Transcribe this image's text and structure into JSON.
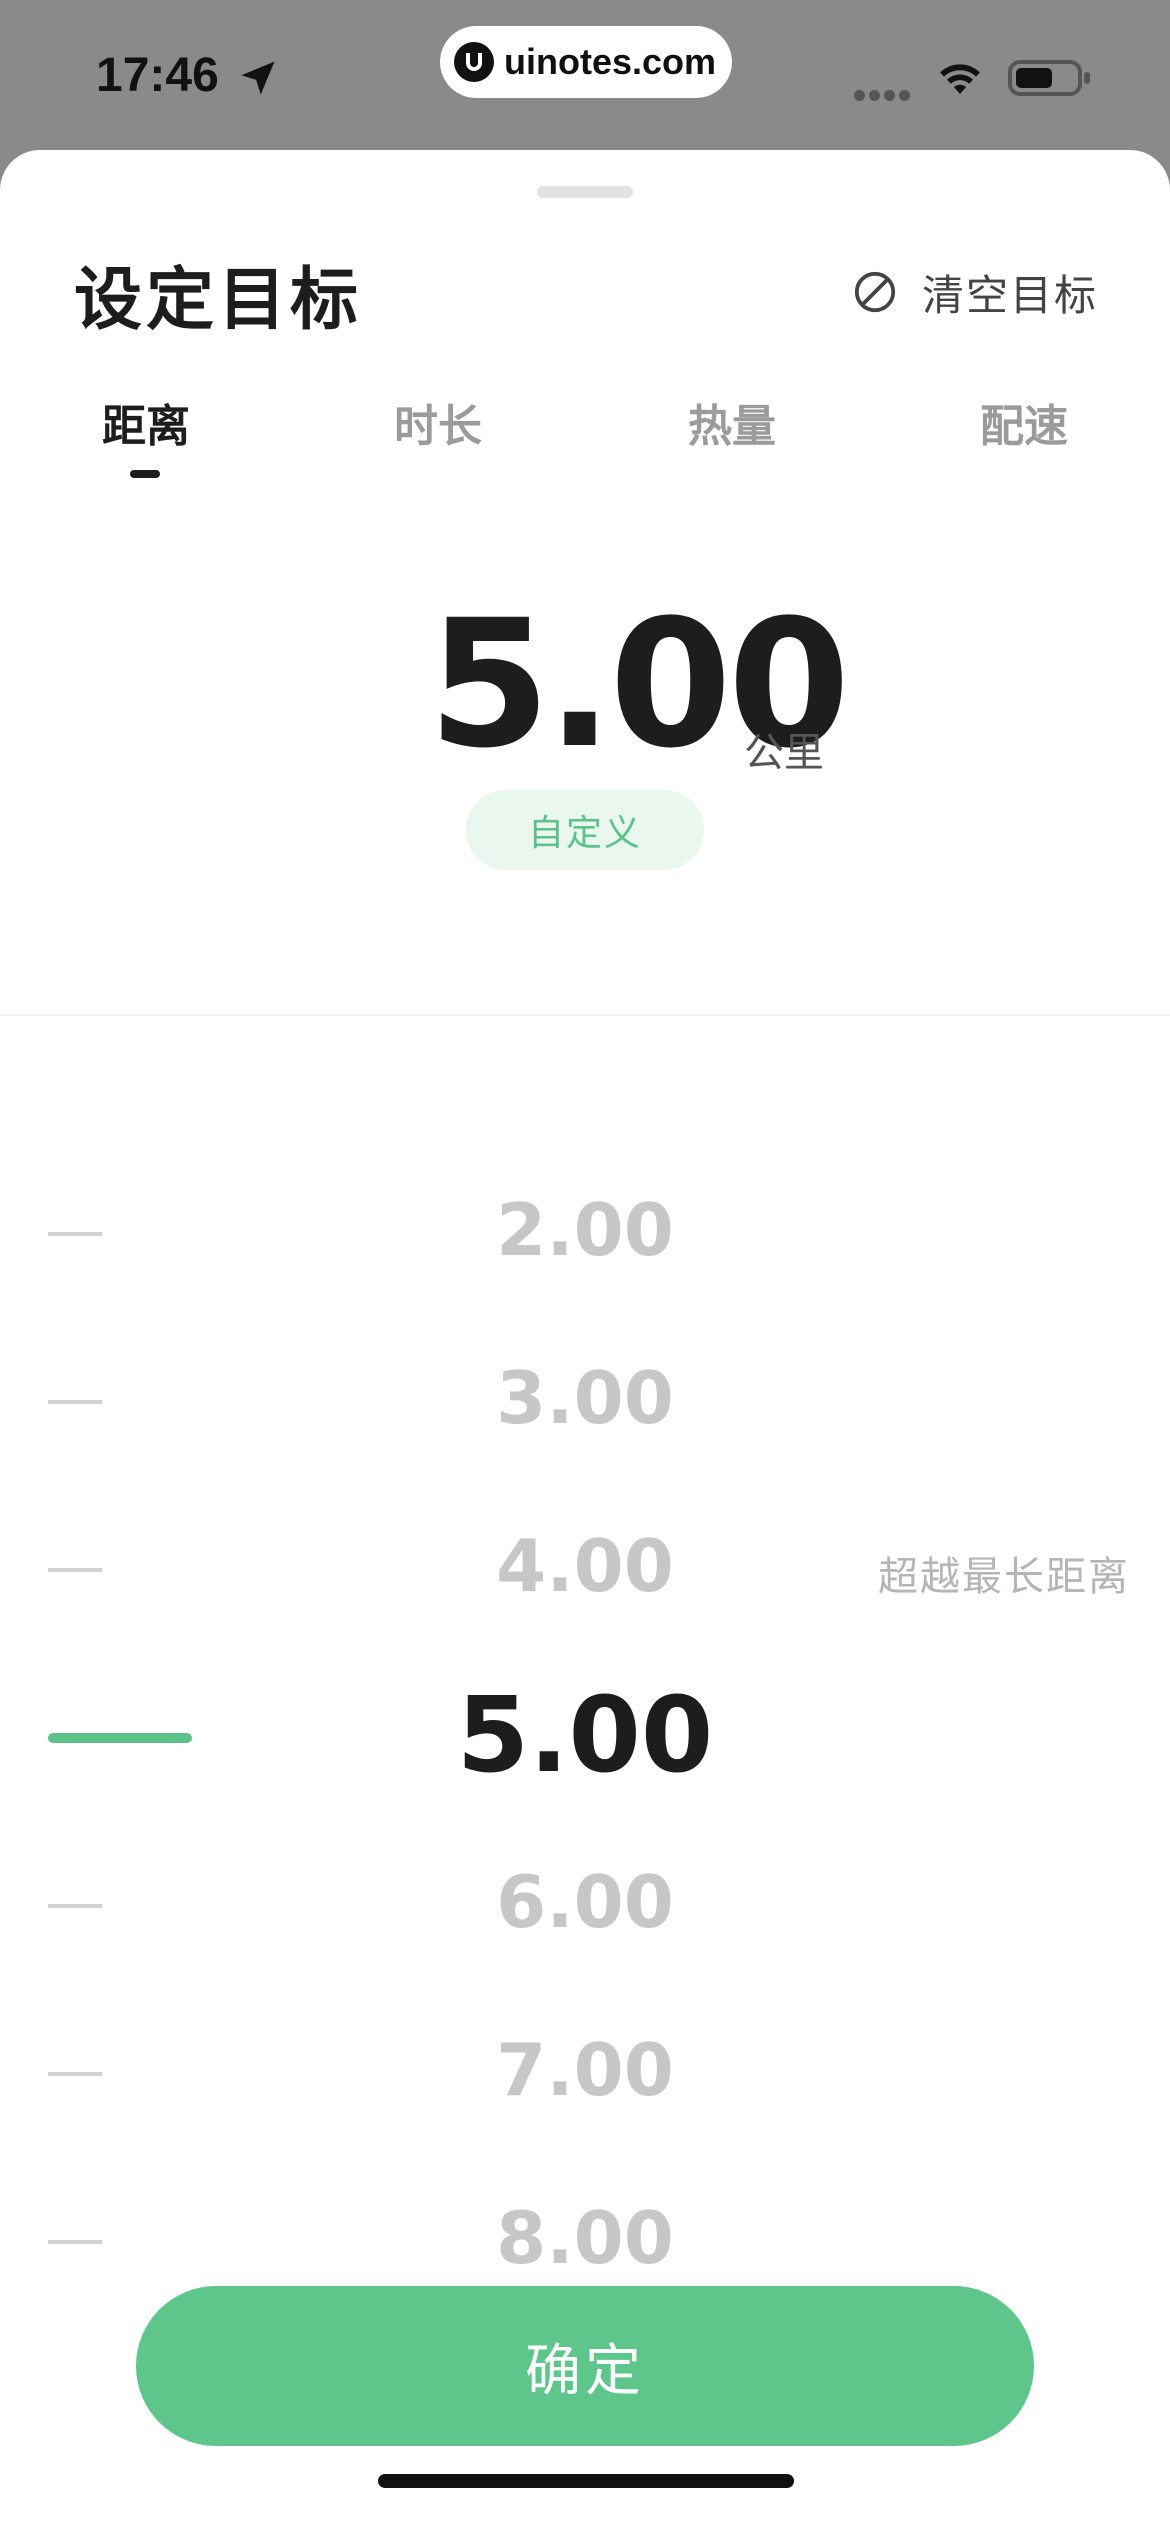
{
  "status_bar": {
    "time": "17:46",
    "url": "uinotes.com"
  },
  "sheet": {
    "title": "设定目标",
    "clear_label": "清空目标"
  },
  "tabs": [
    {
      "label": "距离",
      "active": true
    },
    {
      "label": "时长",
      "active": false
    },
    {
      "label": "热量",
      "active": false
    },
    {
      "label": "配速",
      "active": false
    }
  ],
  "goal": {
    "value": "5.00",
    "unit": "公里",
    "custom_label": "自定义"
  },
  "picker": {
    "options": [
      "2.00",
      "3.00",
      "4.00",
      "5.00",
      "6.00",
      "7.00",
      "8.00"
    ],
    "selected": "5.00",
    "note": "超越最长距离"
  },
  "confirm_label": "确定",
  "colors": {
    "accent": "#5ec58b",
    "accent_light": "#e9f7ef",
    "text_primary": "#1d1d1d",
    "text_muted": "#c7c7c7"
  }
}
